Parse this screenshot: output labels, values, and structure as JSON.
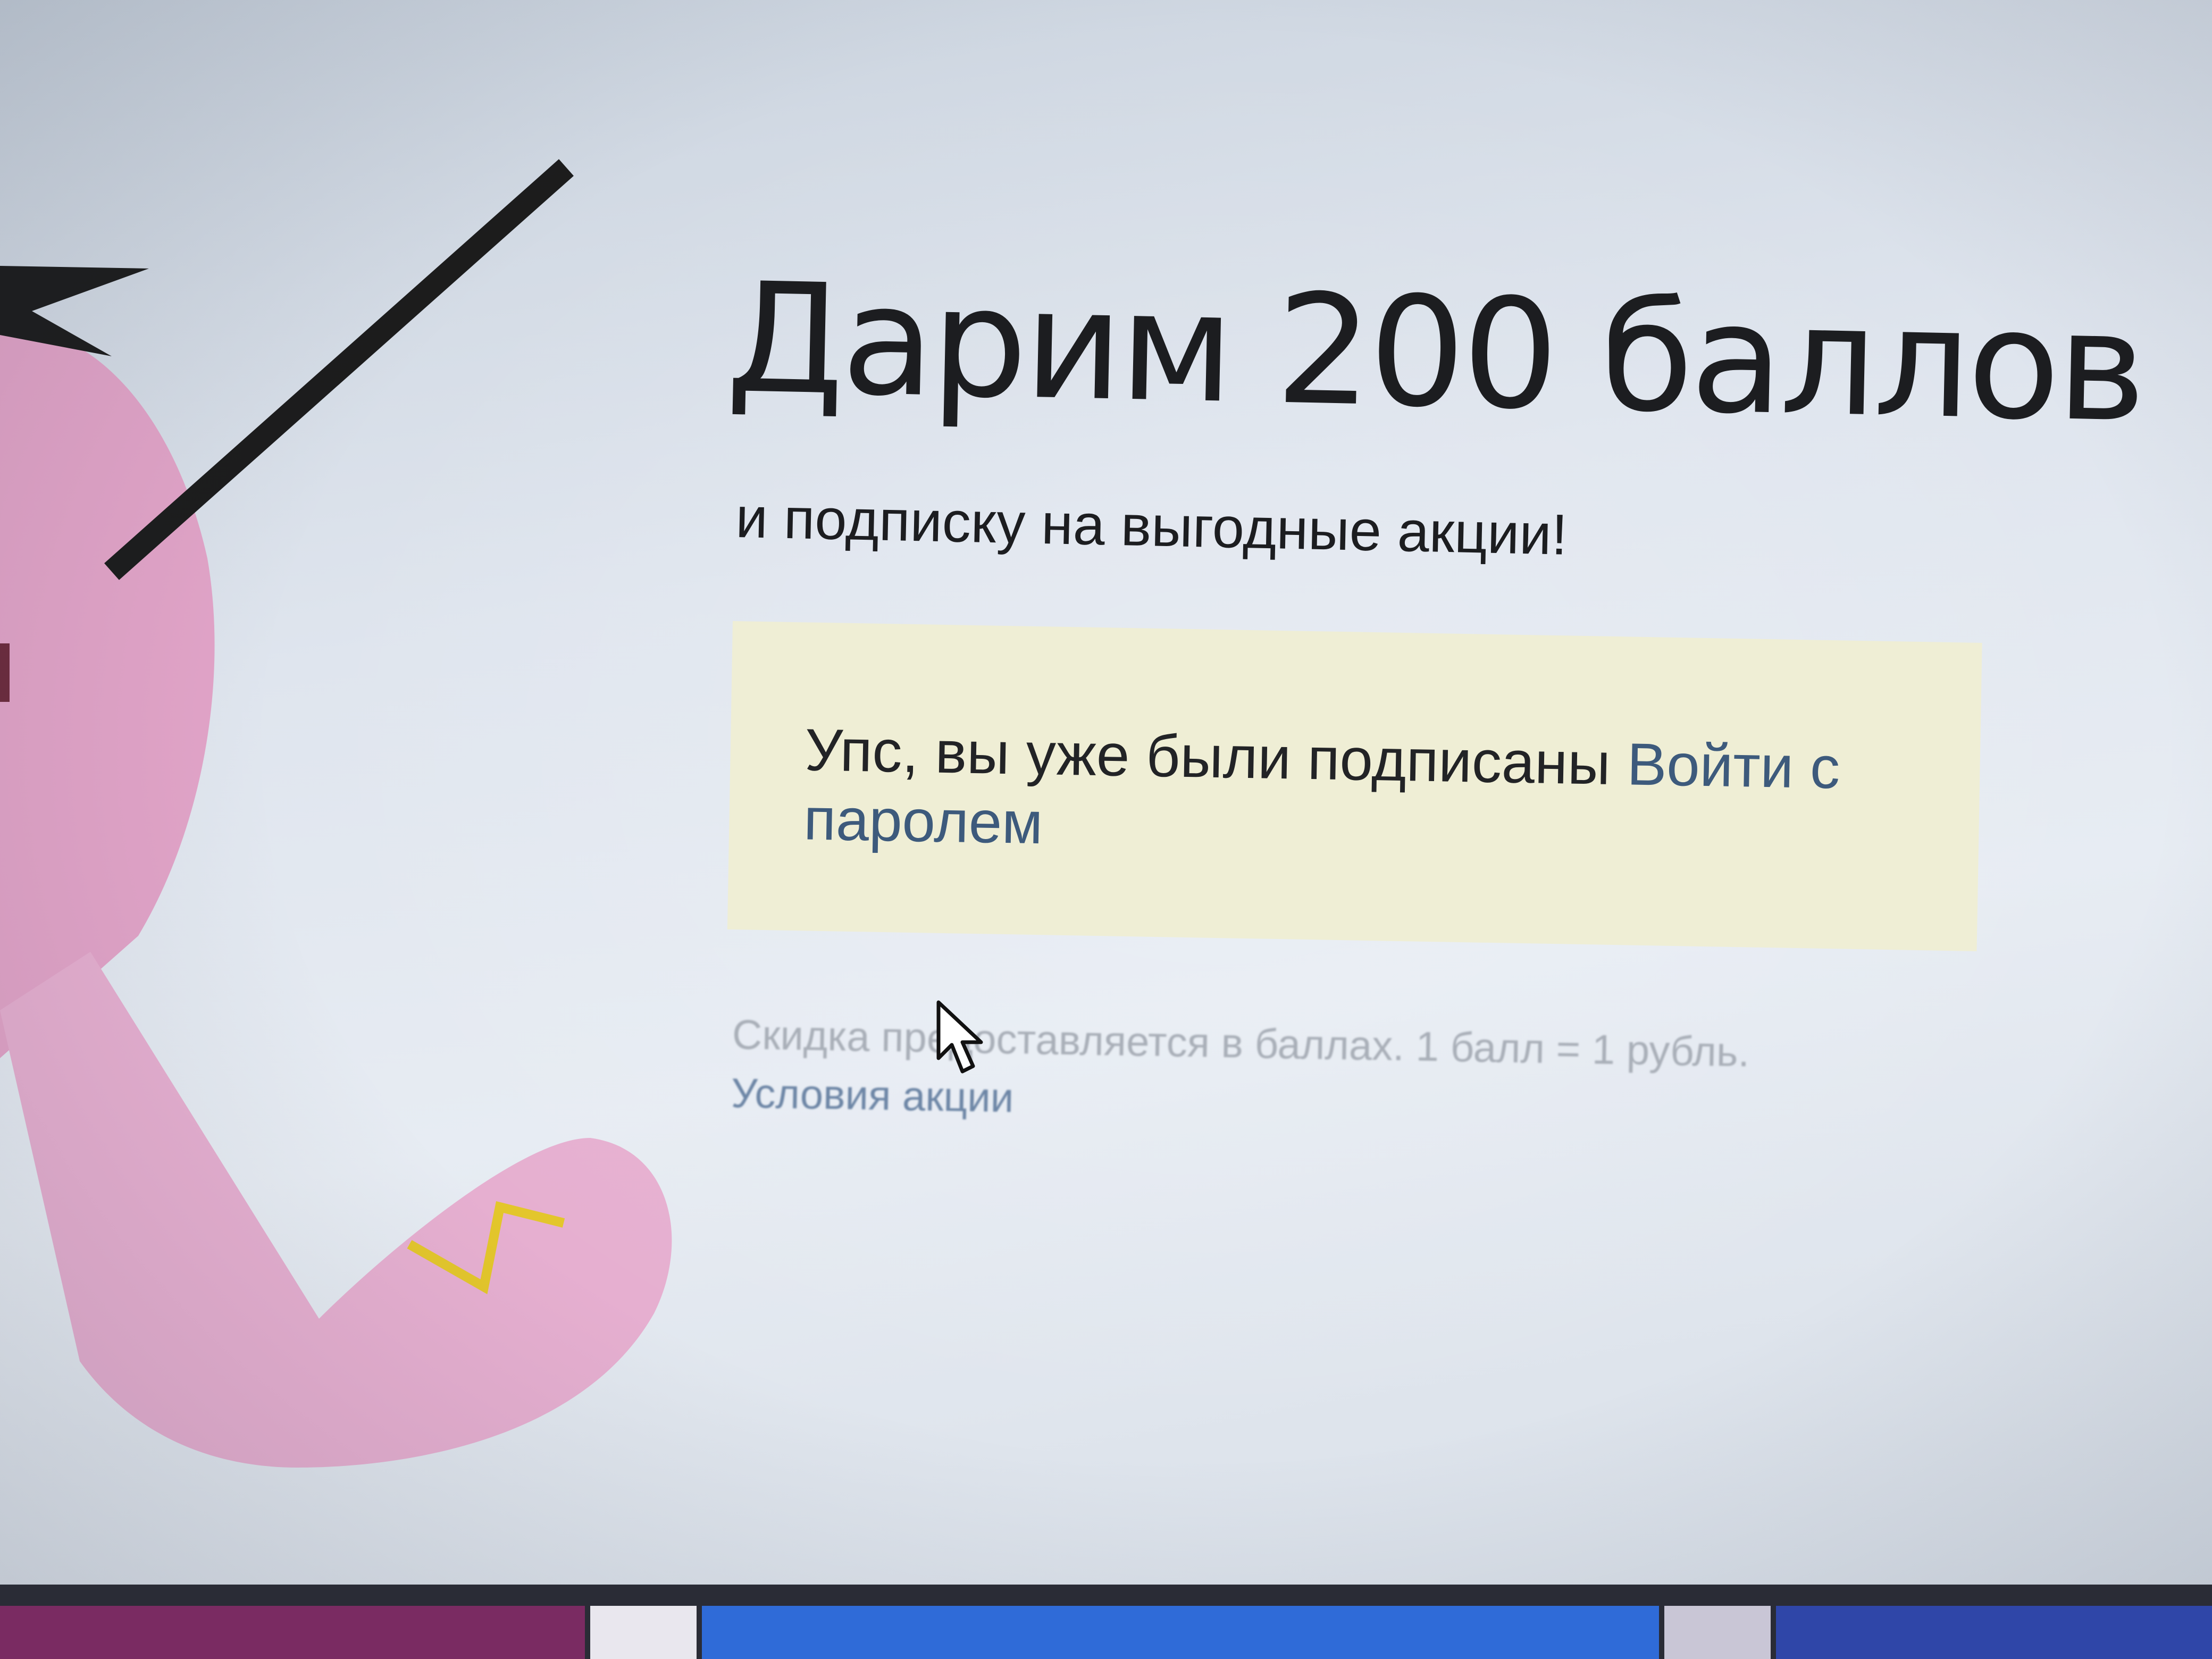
{
  "promo": {
    "title": "Дарим 200 баллов",
    "subtitle": "и подписку на выгодные акции!"
  },
  "notice": {
    "message": "Упс, вы уже были подписаны",
    "login_link": "Войти с паролем"
  },
  "footnote": {
    "text": "Скидка предоставляется в баллах. 1 балл = 1 рубль.",
    "terms_link": "Условия акции"
  },
  "colors": {
    "notice_background": "#efeed5",
    "link": "#3d5a7c",
    "illustration_pink": "#e2a4c8",
    "accent_yellow": "#e3c62b"
  }
}
